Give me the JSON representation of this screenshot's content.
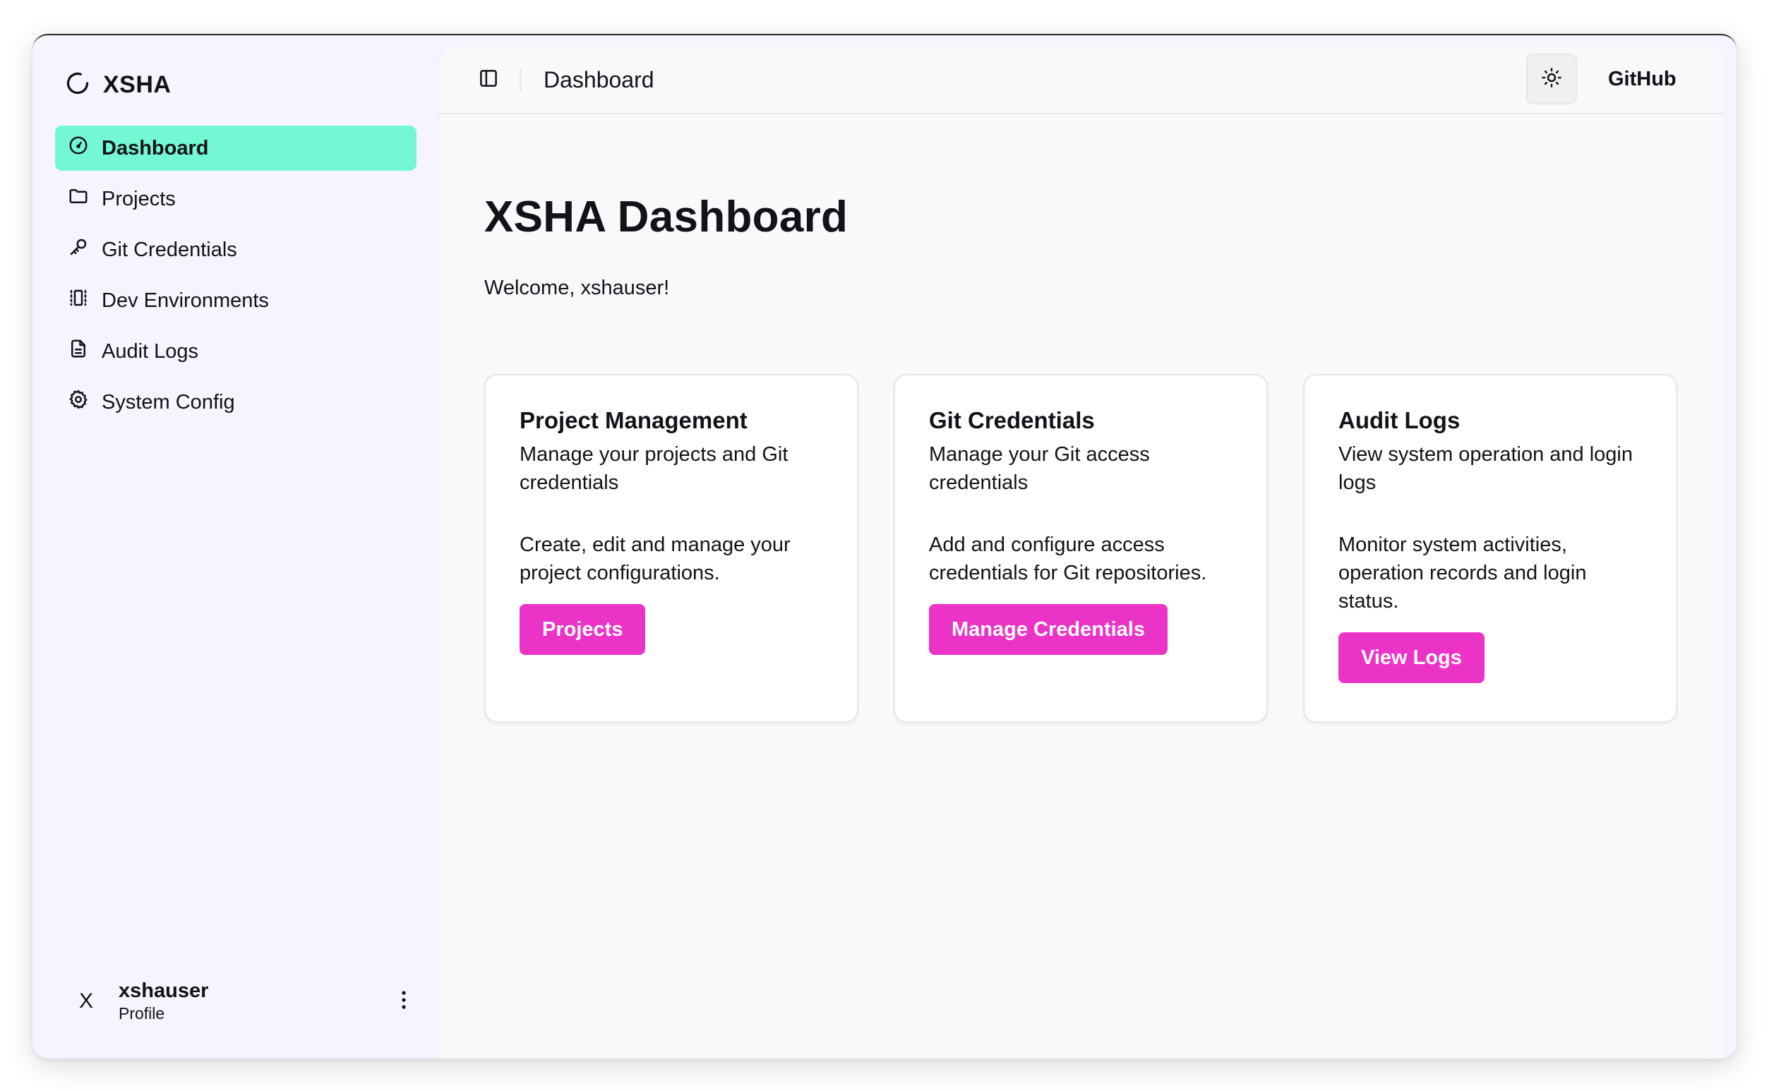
{
  "app": {
    "brand": "XSHA"
  },
  "sidebar": {
    "items": [
      {
        "label": "Dashboard",
        "icon": "gauge-icon",
        "active": true
      },
      {
        "label": "Projects",
        "icon": "folder-icon",
        "active": false
      },
      {
        "label": "Git Credentials",
        "icon": "key-icon",
        "active": false
      },
      {
        "label": "Dev Environments",
        "icon": "container-icon",
        "active": false
      },
      {
        "label": "Audit Logs",
        "icon": "file-text-icon",
        "active": false
      },
      {
        "label": "System Config",
        "icon": "gear-icon",
        "active": false
      }
    ],
    "user": {
      "avatar_initial": "X",
      "name": "xshauser",
      "sub": "Profile"
    }
  },
  "topbar": {
    "title": "Dashboard",
    "github_label": "GitHub"
  },
  "main": {
    "title": "XSHA Dashboard",
    "subtitle": "Welcome, xshauser!",
    "cards": [
      {
        "title": "Project Management",
        "desc": "Manage your projects and Git credentials",
        "body": "Create, edit and manage your project configurations.",
        "button": "Projects"
      },
      {
        "title": "Git Credentials",
        "desc": "Manage your Git access credentials",
        "body": "Add and configure access credentials for Git repositories.",
        "button": "Manage Credentials"
      },
      {
        "title": "Audit Logs",
        "desc": "View system operation and login logs",
        "body": "Monitor system activities, operation records and login status.",
        "button": "View Logs"
      }
    ]
  },
  "colors": {
    "active_nav": "#74f8d3",
    "primary_button": "#ec33c8",
    "sidebar_bg": "#f5f4ff",
    "main_bg": "#f9f9fb"
  }
}
